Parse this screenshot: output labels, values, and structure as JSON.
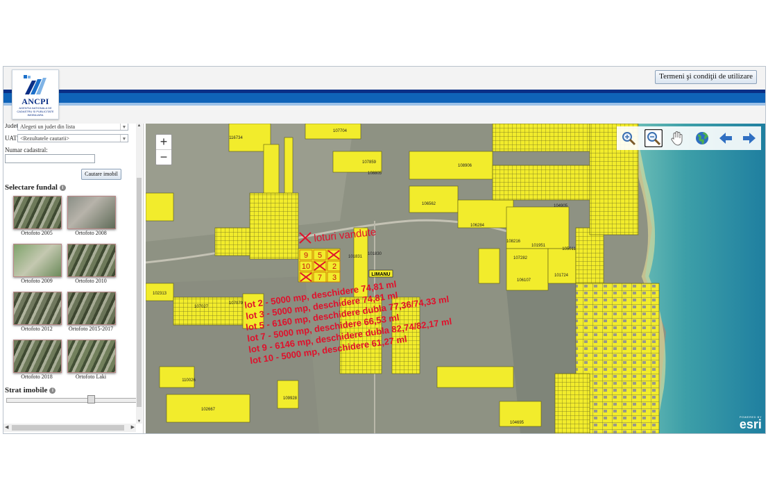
{
  "header": {
    "logo_name": "ANCPI",
    "logo_sub": "AGENTIA NATIONALA DE CADASTRU SI PUBLICITATE IMOBILIARA",
    "terms_button": "Termeni şi condiţii de utilizare"
  },
  "sidebar": {
    "judet_label": "Judet:",
    "judet_value": "Alegeti un judet din lista",
    "uat_label": "UAT:",
    "uat_value": "<Rezultatele cautarii>",
    "cadastral_label": "Numar cadastral:",
    "cadastral_value": "",
    "search_button": "Cautare imobil",
    "basemap_title": "Selectare fundal",
    "basemaps": [
      {
        "label": "Ortofoto 2005",
        "icon": "ortofoto-2005-thumbnail"
      },
      {
        "label": "Ortofoto 2008",
        "icon": "ortofoto-2008-thumbnail"
      },
      {
        "label": "Ortofoto 2009",
        "icon": "ortofoto-2009-thumbnail"
      },
      {
        "label": "Ortofoto 2010",
        "icon": "ortofoto-2010-thumbnail"
      },
      {
        "label": "Ortofoto 2012",
        "icon": "ortofoto-2012-thumbnail"
      },
      {
        "label": "Ortofoto 2015-2017",
        "icon": "ortofoto-2015-2017-thumbnail"
      },
      {
        "label": "Ortofoto 2018",
        "icon": "ortofoto-2018-thumbnail"
      },
      {
        "label": "Ortofoto Laki",
        "icon": "ortofoto-laki-thumbnail"
      }
    ],
    "layer_title": "Strat imobile",
    "layer_opacity_percent": 65
  },
  "map": {
    "zoom_in": "+",
    "zoom_out": "−",
    "tools": [
      "zoom-in-icon",
      "zoom-out-icon",
      "pan-hand-icon",
      "full-extent-globe-icon",
      "previous-extent-icon",
      "next-extent-icon"
    ],
    "parcel_labels": [
      "116734",
      "107704",
      "107859",
      "108805",
      "108906",
      "106562",
      "106284",
      "104905",
      "108216",
      "101951",
      "105011",
      "107282",
      "106107",
      "101724",
      "101831",
      "101830",
      "102313",
      "107027",
      "107079",
      "110026",
      "109928",
      "102667",
      "104695"
    ],
    "place_label": "LIMANU",
    "sold_note": "loturi vandute",
    "lot_numbers": [
      "9",
      "5",
      "10",
      "2",
      "7",
      "3"
    ],
    "lots": [
      "lot 2 - 5000 mp, deschidere 74,81 ml",
      "lot 3 - 5000 mp, deschidere 74,81 ml",
      "lot 5 - 6160 mp, deschidere dubla 77,36/74,33 ml",
      "lot 7 - 5000 mp, deschidere 66,53 ml",
      "lot 9 - 6146 mp, deschidere dubla 82,74/82,17 ml",
      "lot 10 - 5000 mp, deschidere 61,27 ml"
    ],
    "attribution_small": "POWERED BY",
    "attribution": "esri"
  }
}
